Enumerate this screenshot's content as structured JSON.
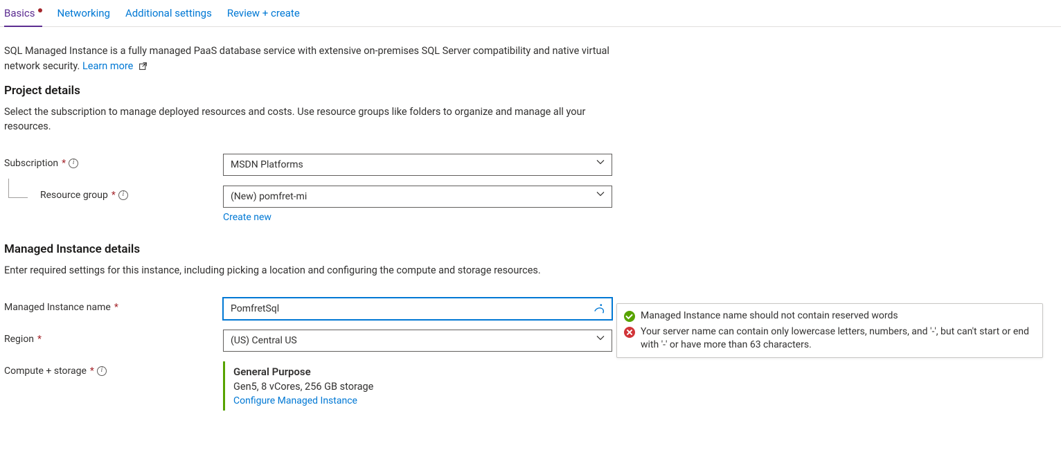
{
  "tabs": {
    "basics": "Basics",
    "networking": "Networking",
    "additional": "Additional settings",
    "review": "Review + create"
  },
  "intro": {
    "text": "SQL Managed Instance is a fully managed PaaS database service with extensive on-premises SQL Server compatibility and native virtual network security.",
    "learn_more": "Learn more"
  },
  "project": {
    "heading": "Project details",
    "desc": "Select the subscription to manage deployed resources and costs. Use resource groups like folders to organize and manage all your resources.",
    "subscription_label": "Subscription",
    "subscription_value": "MSDN Platforms",
    "resource_group_label": "Resource group",
    "resource_group_value": "(New) pomfret-mi",
    "create_new": "Create new"
  },
  "instance": {
    "heading": "Managed Instance details",
    "desc": "Enter required settings for this instance, including picking a location and configuring the compute and storage resources.",
    "name_label": "Managed Instance name",
    "name_value": "PomfretSql",
    "region_label": "Region",
    "region_value": "(US) Central US",
    "compute_label": "Compute + storage",
    "compute_title": "General Purpose",
    "compute_sub": "Gen5, 8 vCores, 256 GB storage",
    "configure_link": "Configure Managed Instance"
  },
  "validation": {
    "ok": "Managed Instance name should not contain reserved words",
    "err": "Your server name can contain only lowercase letters, numbers, and '-', but can't start or end with '-' or have more than 63 characters."
  }
}
